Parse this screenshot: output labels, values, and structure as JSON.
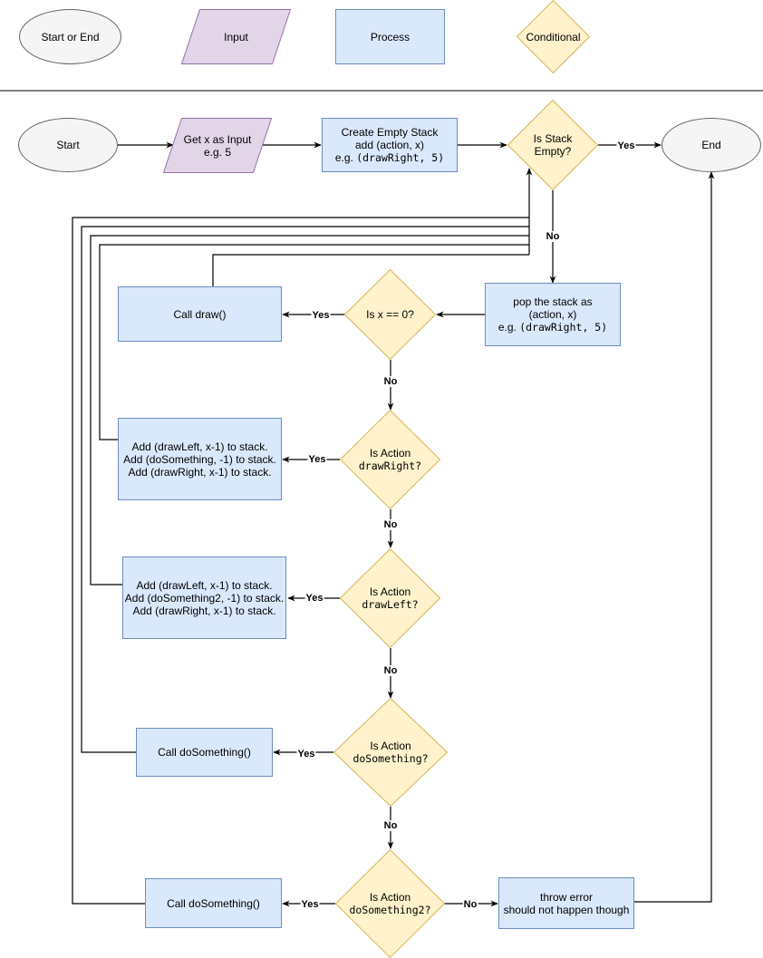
{
  "colors": {
    "process_fill": "#dae8fc",
    "process_stroke": "#6c8ebf",
    "terminal_fill": "#f5f5f5",
    "terminal_stroke": "#666666",
    "input_fill": "#e1d5e7",
    "input_stroke": "#9673a6",
    "decision_fill": "#fff2cc",
    "decision_stroke": "#d6b656",
    "line": "#000000"
  },
  "legend": {
    "terminal": "Start or End",
    "input": "Input",
    "process": "Process",
    "conditional": "Conditional"
  },
  "nodes": {
    "start": "Start",
    "get_input": {
      "line1": "Get x as Input",
      "line2": "e.g. 5"
    },
    "create_stack": {
      "line1": "Create Empty Stack",
      "line2": "add (action, x)",
      "line3_prefix": "e.g. ",
      "line3_code": "(drawRight, 5)"
    },
    "is_stack_empty": "Is Stack\nEmpty?",
    "end": "End",
    "pop_stack": {
      "line1": "pop the stack as",
      "line2": "(action, x)",
      "line3_prefix": "e.g. ",
      "line3_code": "(drawRight, 5)"
    },
    "is_x_zero": "Is x == 0?",
    "call_draw": "Call draw()",
    "is_draw_right": {
      "line1": "Is Action",
      "code": "drawRight?"
    },
    "add_draw_right": "Add (drawLeft, x-1) to stack.\nAdd (doSomething, -1) to stack.\nAdd (drawRight, x-1) to stack.",
    "is_draw_left": {
      "line1": "Is Action",
      "code": "drawLeft?"
    },
    "add_draw_left": "Add (drawLeft, x-1) to stack.\nAdd (doSomething2, -1) to stack.\nAdd (drawRight, x-1) to stack.",
    "is_do_something": {
      "line1": "Is Action",
      "code": "doSomething?"
    },
    "call_do_something": "Call doSomething()",
    "is_do_something2": {
      "line1": "Is Action",
      "code": "doSomething2?"
    },
    "call_do_something_2": "Call doSomething()",
    "throw_error": "throw error\nshould not happen though"
  },
  "edge_labels": {
    "stack_empty_yes": "Yes",
    "stack_empty_no": "No",
    "x_zero_yes": "Yes",
    "x_zero_no": "No",
    "draw_right_yes": "Yes",
    "draw_right_no": "No",
    "draw_left_yes": "Yes",
    "draw_left_no": "No",
    "do_something_yes": "Yes",
    "do_something_no": "No",
    "do_something2_yes": "Yes",
    "do_something2_no": "No"
  }
}
